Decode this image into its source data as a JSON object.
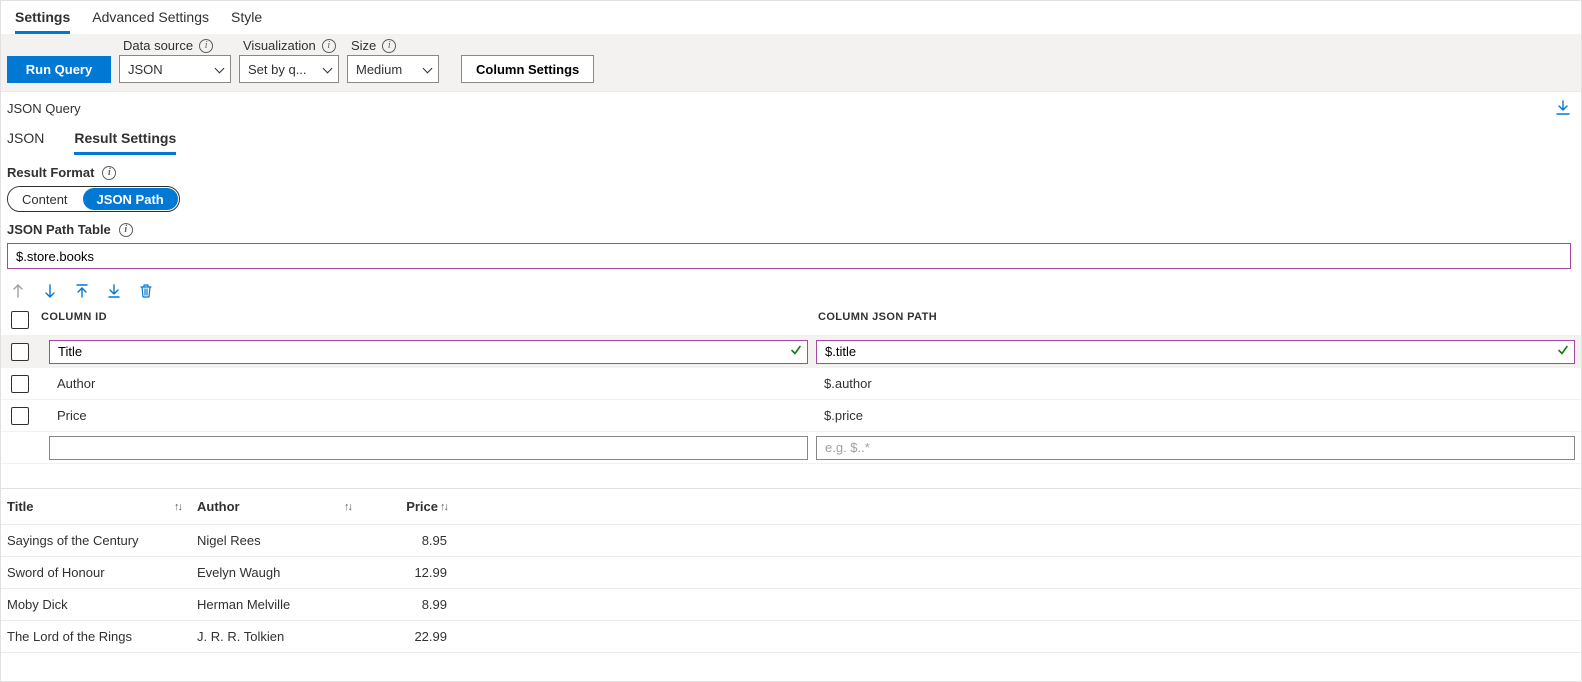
{
  "tabs": {
    "settings": "Settings",
    "advanced": "Advanced Settings",
    "style": "Style"
  },
  "toolbar": {
    "run_query": "Run Query",
    "data_source_label": "Data source",
    "data_source_value": "JSON",
    "visualization_label": "Visualization",
    "visualization_value": "Set by q...",
    "size_label": "Size",
    "size_value": "Medium",
    "column_settings": "Column Settings"
  },
  "section": {
    "json_query": "JSON Query"
  },
  "inner_tabs": {
    "json": "JSON",
    "result_settings": "Result Settings"
  },
  "result_format": {
    "label": "Result Format",
    "content": "Content",
    "json_path": "JSON Path"
  },
  "json_path_table": {
    "label": "JSON Path Table",
    "value": "$.store.books"
  },
  "cols_header": {
    "id": "COLUMN ID",
    "path": "COLUMN JSON PATH"
  },
  "cols": [
    {
      "id": "Title",
      "path": "$.title"
    },
    {
      "id": "Author",
      "path": "$.author"
    },
    {
      "id": "Price",
      "path": "$.price"
    }
  ],
  "new_col_placeholder_path": "e.g. $..*",
  "results_header": {
    "title": "Title",
    "author": "Author",
    "price": "Price"
  },
  "results": [
    {
      "title": "Sayings of the Century",
      "author": "Nigel Rees",
      "price": "8.95"
    },
    {
      "title": "Sword of Honour",
      "author": "Evelyn Waugh",
      "price": "12.99"
    },
    {
      "title": "Moby Dick",
      "author": "Herman Melville",
      "price": "8.99"
    },
    {
      "title": "The Lord of the Rings",
      "author": "J. R. R. Tolkien",
      "price": "22.99"
    }
  ]
}
